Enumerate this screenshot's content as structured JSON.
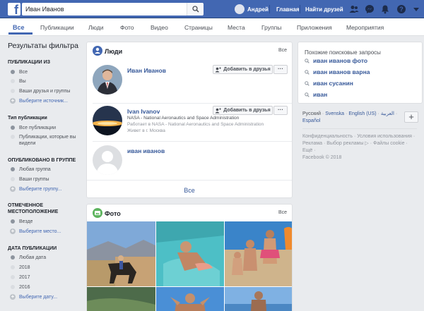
{
  "topbar": {
    "search_value": "Иван Иванов",
    "user_name": "Андрей",
    "home": "Главная",
    "find_friends": "Найти друзей"
  },
  "tabs": [
    "Все",
    "Публикации",
    "Люди",
    "Фото",
    "Видео",
    "Страницы",
    "Места",
    "Группы",
    "Приложения",
    "Мероприятия"
  ],
  "sidebar": {
    "title": "Результаты фильтра",
    "sections": [
      {
        "heading": "ПУБЛИКАЦИИ ИЗ",
        "options": [
          "Все",
          "Вы",
          "Ваши друзья и группы"
        ],
        "action": "Выберите источник..."
      },
      {
        "heading": "Тип публикации",
        "options": [
          "Все публикации",
          "Публикации, которые вы видели"
        ]
      },
      {
        "heading": "ОПУБЛИКОВАНО В ГРУППЕ",
        "options": [
          "Любая группа",
          "Ваши группы"
        ],
        "action": "Выберите группу..."
      },
      {
        "heading": "ОТМЕЧЕННОЕ МЕСТОПОЛОЖЕНИЕ",
        "options": [
          "Везде"
        ],
        "action": "Выберите место..."
      },
      {
        "heading": "ДАТА ПУБЛИКАЦИИ",
        "options": [
          "Любая дата",
          "2018",
          "2017",
          "2016"
        ],
        "action": "Выберите дату..."
      }
    ]
  },
  "people": {
    "title": "Люди",
    "see_all_top": "Все",
    "add_label": "Добавить в друзья",
    "more_label": "···",
    "items": [
      {
        "name": "Иван Иванов"
      },
      {
        "name": "Ivan Ivanov",
        "line1": "NASA - National Aeronautics and Space Administration",
        "line2": "Работает в NASA - National Aeronautics and Space Administration",
        "line3": "Живет в г. Москва"
      },
      {
        "name": "иван иванов"
      }
    ],
    "see_all": "Все"
  },
  "photos": {
    "title": "Фото",
    "see_all_top": "Все"
  },
  "related": {
    "title": "Похожие поисковые запросы",
    "items": [
      "иван иванов фото",
      "иван иванов варна",
      "иван сусанин",
      "иван"
    ]
  },
  "languages": {
    "current": "Русский",
    "others": [
      "Svenska",
      "English (US)",
      "العربية",
      "Español"
    ]
  },
  "footer": {
    "links": "Конфиденциальность · Условия использования · Реклама · Выбор рекламы ▷ · Файлы cookie · Ещё ·",
    "copyright": "Facebook © 2018"
  },
  "colors": {
    "brand": "#4267b2",
    "link": "#365899"
  }
}
